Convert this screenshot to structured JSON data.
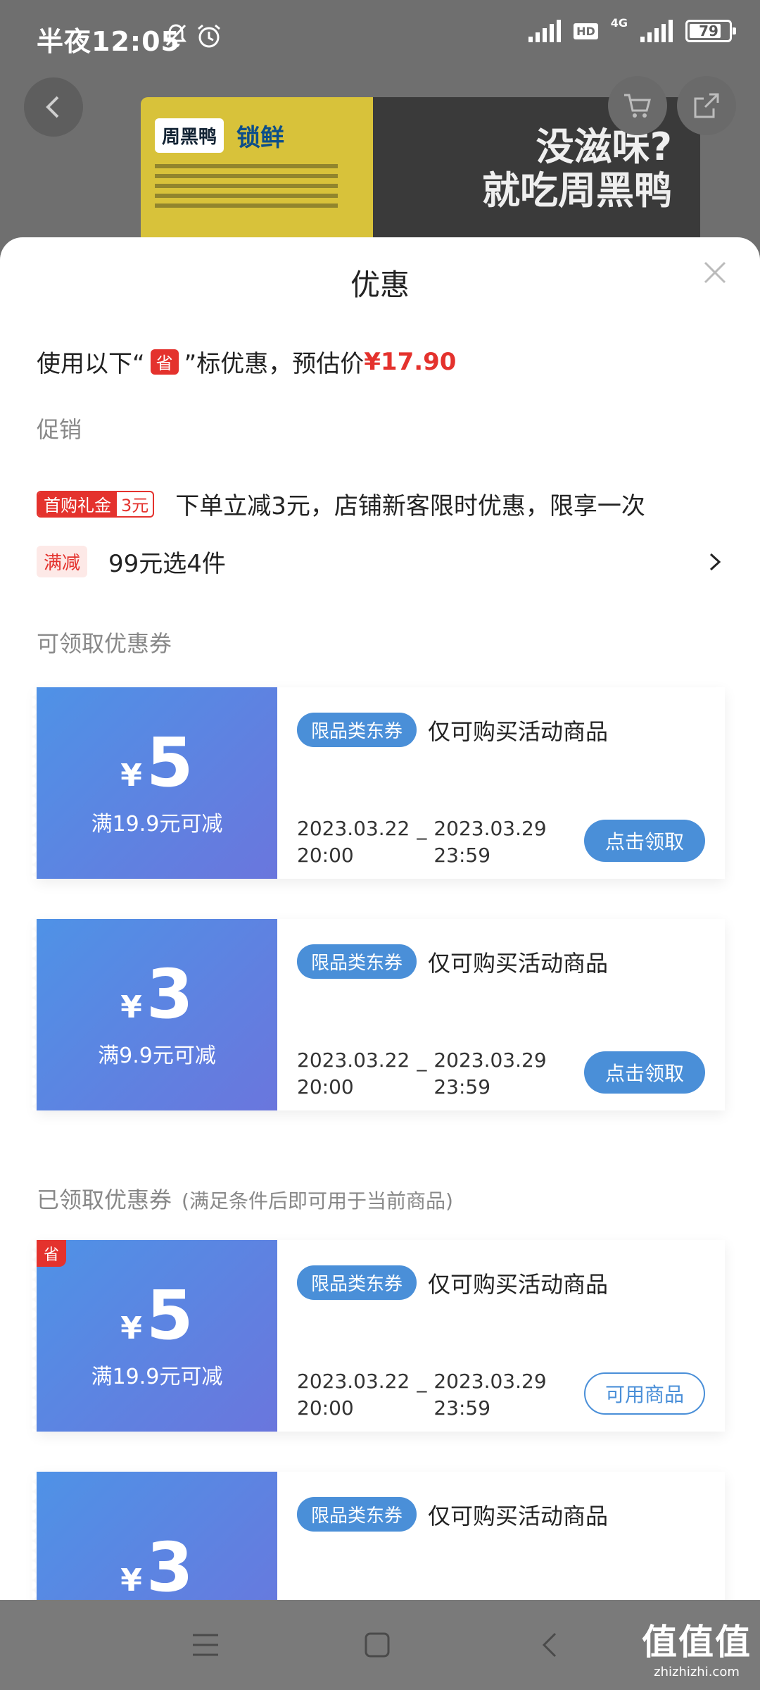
{
  "status_bar": {
    "time": "半夜12:05",
    "hd": "HD",
    "network": "4G",
    "battery": "79"
  },
  "product": {
    "brand_1": "周黑鸭",
    "brand_2": "锁鲜",
    "slogan_1": "没滋味?",
    "slogan_2": "就吃周黑鸭"
  },
  "sheet": {
    "title": "优惠",
    "estimate_prefix": "使用以下“",
    "estimate_icon": "省",
    "estimate_middle": "”标优惠，预估价",
    "estimate_price": "¥17.90",
    "promo_section": "促销",
    "first_gift_tag": "首购礼金",
    "first_gift_amount": "3元",
    "first_gift_text": "下单立减3元，店铺新客限时优惠，限享一次",
    "full_reduce_tag": "满减",
    "full_reduce_text": "99元选4件",
    "claimable_section": "可领取优惠券",
    "claimed_section": "已领取优惠券",
    "claimed_note": "(满足条件后即可用于当前商品)"
  },
  "coupons": [
    {
      "currency": "¥",
      "amount": "5",
      "condition": "满19.9元可减",
      "category": "限品类东券",
      "desc": "仅可购买活动商品",
      "start_date": "2023.03.22",
      "start_time": "20:00",
      "end_date": "2023.03.29",
      "end_time": "23:59",
      "button": "点击领取"
    },
    {
      "currency": "¥",
      "amount": "3",
      "condition": "满9.9元可减",
      "category": "限品类东券",
      "desc": "仅可购买活动商品",
      "start_date": "2023.03.22",
      "start_time": "20:00",
      "end_date": "2023.03.29",
      "end_time": "23:59",
      "button": "点击领取"
    },
    {
      "currency": "¥",
      "amount": "5",
      "condition": "满19.9元可减",
      "category": "限品类东券",
      "desc": "仅可购买活动商品",
      "start_date": "2023.03.22",
      "start_time": "20:00",
      "end_date": "2023.03.29",
      "end_time": "23:59",
      "button": "可用商品",
      "corner": "省"
    },
    {
      "currency": "¥",
      "amount": "3",
      "category": "限品类东券",
      "desc": "仅可购买活动商品"
    }
  ],
  "watermark": {
    "main": "值值值",
    "sub": "zhizhizhi.com"
  }
}
